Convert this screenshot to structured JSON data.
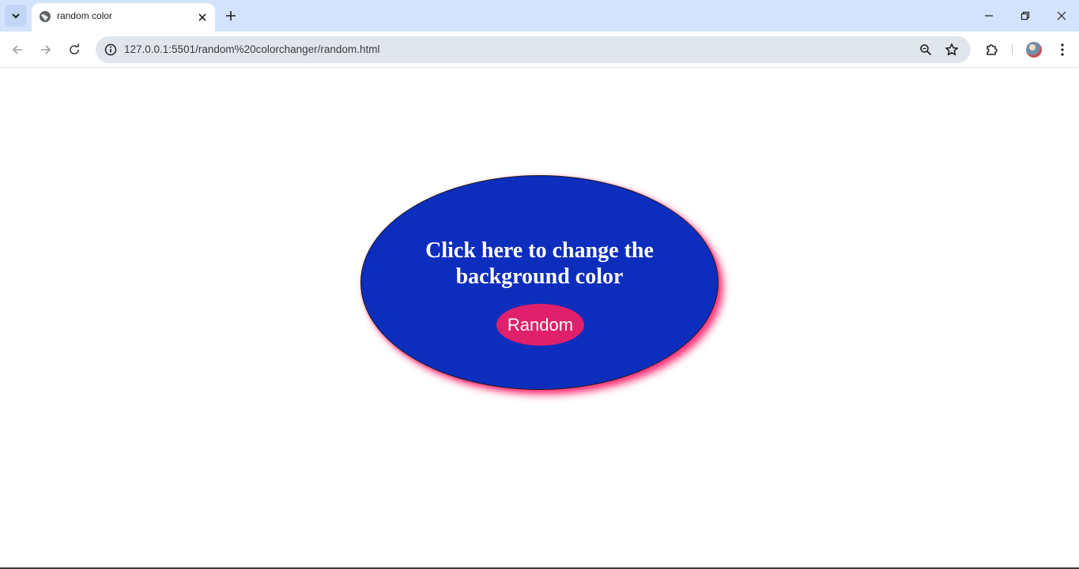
{
  "browser": {
    "tab": {
      "title": "random color"
    },
    "url": "127.0.0.1:5501/random%20colorchanger/random.html",
    "icons": [
      "tab-search-icon",
      "globe-icon",
      "close-icon",
      "plus-icon",
      "minimize-icon",
      "restore-icon",
      "window-close-icon",
      "back-icon",
      "forward-icon",
      "reload-icon",
      "site-info-icon",
      "zoom-icon",
      "star-icon",
      "extensions-icon",
      "avatar",
      "menu-icon"
    ]
  },
  "page": {
    "heading_line1": "Click here to change the",
    "heading_line2": "background color",
    "button_label": "Random"
  },
  "colors": {
    "ellipse_fill": "#0d2dbd",
    "ellipse_glow": "#ff3d7f",
    "button_fill": "#e0206a",
    "text": "#ffffff",
    "tabstrip": "#d3e3fd",
    "omnibox": "#e1e5ec"
  }
}
